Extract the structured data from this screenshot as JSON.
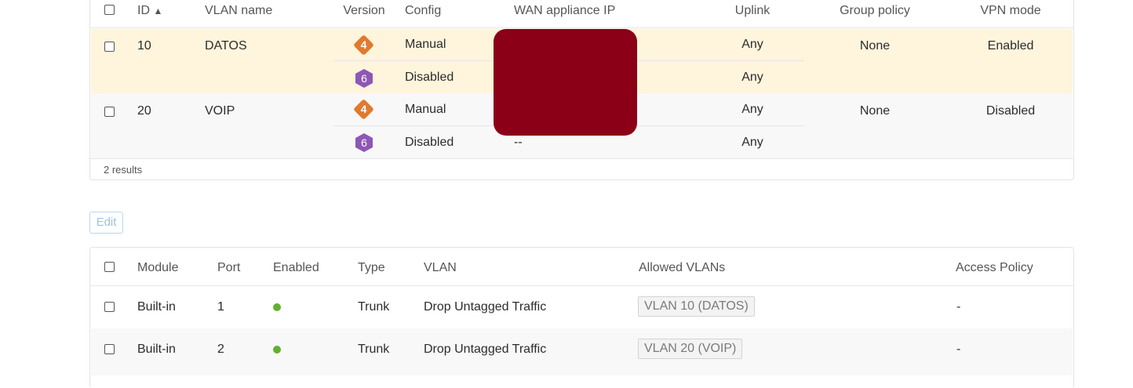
{
  "vlan_table": {
    "headers": {
      "id": "ID",
      "id_sort": "▲",
      "vlan_name": "VLAN name",
      "version": "Version",
      "config": "Config",
      "wan_ip": "WAN appliance IP",
      "uplink": "Uplink",
      "group_policy": "Group policy",
      "vpn_mode": "VPN mode"
    },
    "rows": [
      {
        "id": "10",
        "name": "DATOS",
        "v4_badge": "4",
        "v4_config": "Manual",
        "v4_uplink": "Any",
        "v6_badge": "6",
        "v6_config": "Disabled",
        "v6_uplink": "Any",
        "group_policy": "None",
        "vpn_mode": "Enabled"
      },
      {
        "id": "20",
        "name": "VOIP",
        "v4_badge": "4",
        "v4_config": "Manual",
        "v4_uplink": "Any",
        "v6_badge": "6",
        "v6_config": "Disabled",
        "v6_wan_ip": "--",
        "v6_uplink": "Any",
        "group_policy": "None",
        "vpn_mode": "Disabled"
      }
    ],
    "results_text": "2 results",
    "highlight_color": "#fff4dc",
    "redaction_color": "#8b0017"
  },
  "edit_button": "Edit",
  "ports_table": {
    "headers": {
      "module": "Module",
      "port": "Port",
      "enabled": "Enabled",
      "type": "Type",
      "vlan": "VLAN",
      "allowed_vlans": "Allowed VLANs",
      "access_policy": "Access Policy"
    },
    "rows": [
      {
        "module": "Built-in",
        "port": "1",
        "enabled": true,
        "type": "Trunk",
        "vlan": "Drop Untagged Traffic",
        "allowed_vlans": "VLAN 10 (DATOS)",
        "access_policy": "-"
      },
      {
        "module": "Built-in",
        "port": "2",
        "enabled": true,
        "type": "Trunk",
        "vlan": "Drop Untagged Traffic",
        "allowed_vlans": "VLAN 20 (VOIP)",
        "access_policy": "-"
      }
    ],
    "enabled_color": "#62b12f"
  }
}
